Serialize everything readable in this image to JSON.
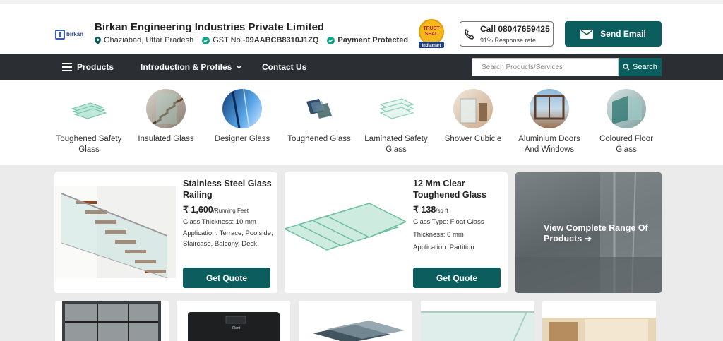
{
  "header": {
    "logo_text": "birkan",
    "company_name": "Birkan Engineering Industries Private Limited",
    "location": "Ghaziabad, Uttar Pradesh",
    "gst_label": "GST No.-",
    "gst_number": "09AABCB8310J1ZQ",
    "payment": "Payment Protected",
    "seal_top": "TRUST",
    "seal_mid": "SEAL",
    "seal_brand": "indiamart",
    "call_label": "Call 08047659425",
    "response_rate": "91% Response rate",
    "send_email": "Send Email"
  },
  "nav": {
    "products": "Products",
    "intro": "Introduction & Profiles",
    "contact": "Contact Us",
    "search_placeholder": "Search Products/Services",
    "search_button": "Search"
  },
  "categories": [
    {
      "label": "Toughened Safety Glass"
    },
    {
      "label": "Insulated Glass"
    },
    {
      "label": "Designer Glass"
    },
    {
      "label": "Toughened Glass"
    },
    {
      "label": "Laminated Safety Glass"
    },
    {
      "label": "Shower Cubicle"
    },
    {
      "label": "Aluminium Doors And Windows"
    },
    {
      "label": "Coloured Floor Glass"
    }
  ],
  "products": [
    {
      "title": "Stainless Steel Glass Railing",
      "currency": "₹",
      "price": "1,600",
      "unit": "/Running Feet",
      "specs": [
        "Glass Thickness: 10 mm",
        "Application: Terrace, Poolside, Staircase, Balcony, Deck"
      ],
      "cta": "Get Quote"
    },
    {
      "title": "12 Mm Clear Toughened Glass",
      "currency": "₹",
      "price": "138",
      "unit": "/sq ft",
      "specs": [
        "Glass Type: Float Glass",
        "Thickness: 6 mm",
        "Application: Partition"
      ],
      "cta": "Get Quote"
    }
  ],
  "view_all": "View Complete Range Of Products",
  "view_all_arrow": "➔",
  "scale_brand": "Zilant",
  "colors": {
    "accent": "#0c5e5e",
    "nav_bg": "#2b2f33",
    "page_bg": "#ebebeb"
  }
}
